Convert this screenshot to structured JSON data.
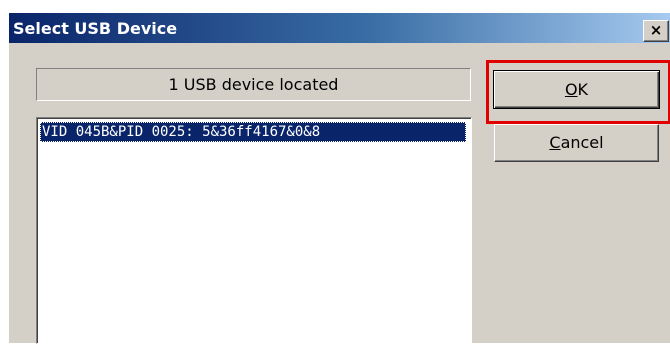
{
  "window": {
    "title": "Select USB Device",
    "close_glyph": "×"
  },
  "status": {
    "text": "1 USB device located"
  },
  "device_list": {
    "items": [
      {
        "label": "VID 045B&PID 0025: 5&36ff4167&0&8",
        "selected": true
      }
    ]
  },
  "buttons": {
    "ok": {
      "accel": "O",
      "rest": "K"
    },
    "cancel": {
      "accel": "C",
      "rest": "ancel"
    }
  },
  "colors": {
    "titlebar_start": "#0a246a",
    "titlebar_end": "#a6caf0",
    "face": "#d4d0c8",
    "selection": "#0a246a",
    "highlight_frame": "#e00000"
  },
  "icons": {
    "close": "close-icon"
  }
}
